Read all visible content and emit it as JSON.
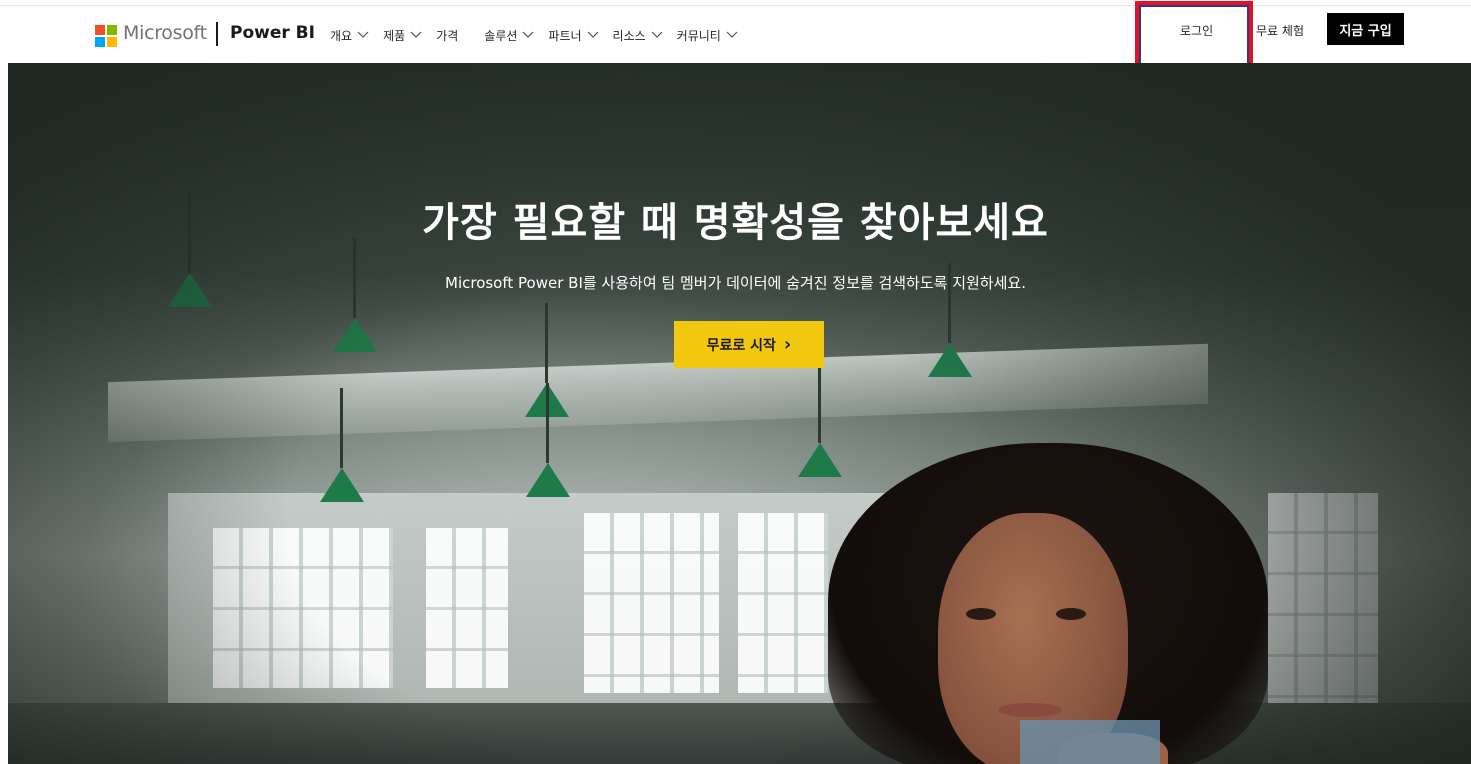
{
  "nav": {
    "microsoft_label": "Microsoft",
    "product_label": "Power BI",
    "menu": [
      {
        "label": "개요",
        "has_dropdown": true
      },
      {
        "label": "제품",
        "has_dropdown": true
      },
      {
        "label": "가격",
        "has_dropdown": false
      },
      {
        "label": "솔루션",
        "has_dropdown": true
      },
      {
        "label": "파트너",
        "has_dropdown": true
      },
      {
        "label": "리소스",
        "has_dropdown": true
      },
      {
        "label": "커뮤니티",
        "has_dropdown": true
      }
    ],
    "signin_label": "로그인",
    "trial_label": "무료 체험",
    "buy_label": "지금 구입"
  },
  "hero": {
    "title": "가장 필요할 때 명확성을 찾아보세요",
    "subtitle": "Microsoft Power BI를 사용하여 팀 멤버가 데이터에 숨겨진 정보를 검색하도록 지원하세요.",
    "cta_label": "무료로 시작",
    "cta_arrow": "›"
  },
  "colors": {
    "ms_red": "#f25022",
    "ms_green": "#7fba00",
    "ms_blue": "#00a4ef",
    "ms_yellow": "#ffb900",
    "cta_yellow": "#f2c811",
    "highlight_red": "#e81123"
  }
}
